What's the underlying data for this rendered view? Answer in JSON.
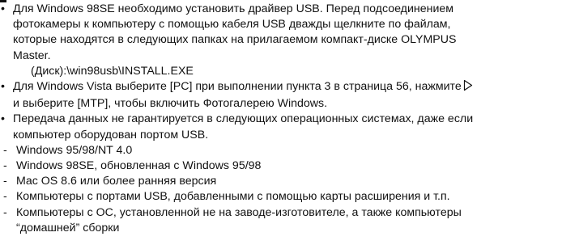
{
  "bullets": [
    {
      "lines": [
        "Для Windows 98SE необходимо установить драйвер USB. Перед подсоединением",
        "фотокамеры к компьютеру с помощью кабеля USB дважды щелкните по файлам,",
        "которые находятся в следующих папках на прилагаемом компакт-диске OLYMPUS",
        "Master."
      ],
      "code": "(Диск):\\win98usb\\INSTALL.EXE"
    },
    {
      "line1": "Для Windows Vista выберите [PC] при выполнении пункта 3 в страница 56, нажмите",
      "line2": "и выберите [MTP], чтобы включить Фотогалерею Windows.",
      "icon": "arrow-right-icon"
    },
    {
      "lines": [
        "Передача данных не гарантируется в следующих операционных системах, даже если",
        "компьютер оборудован портом USB."
      ],
      "items": [
        "Windows 95/98/NT 4.0",
        "Windows 98SE, обновленная с Windows 95/98",
        "Mac OS 8.6 или более ранняя версия",
        "Компьютеры с портами USB, добавленными с помощью карты расширения и т.п."
      ],
      "last_item": [
        "Компьютеры с ОС, установленной не на заводе-изготовителе, а также компьютеры",
        "“домашней” сборки"
      ]
    }
  ]
}
